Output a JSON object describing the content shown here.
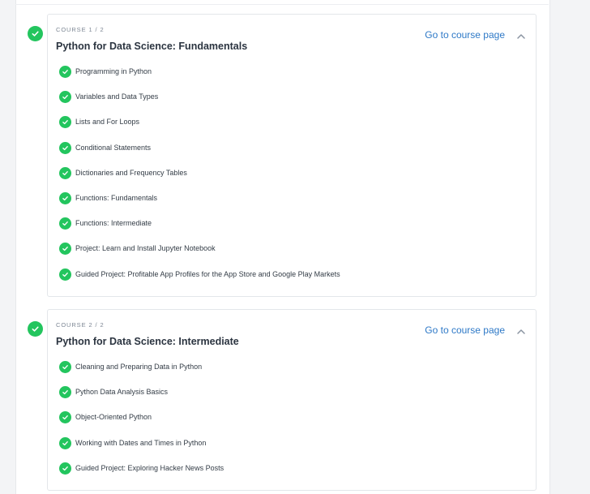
{
  "courses": [
    {
      "label": "COURSE 1 / 2",
      "title": "Python for Data Science: Fundamentals",
      "link_text": "Go to course page",
      "lessons": [
        "Programming in Python",
        "Variables and Data Types",
        "Lists and For Loops",
        "Conditional Statements",
        "Dictionaries and Frequency Tables",
        "Functions: Fundamentals",
        "Functions: Intermediate",
        "Project: Learn and Install Jupyter Notebook",
        "Guided Project: Profitable App Profiles for the App Store and Google Play Markets"
      ]
    },
    {
      "label": "COURSE 2 / 2",
      "title": "Python for Data Science: Intermediate",
      "link_text": "Go to course page",
      "lessons": [
        "Cleaning and Preparing Data in Python",
        "Python Data Analysis Basics",
        "Object-Oriented Python",
        "Working with Dates and Times in Python",
        "Guided Project: Exploring Hacker News Posts"
      ]
    }
  ],
  "colors": {
    "complete": "#23c55e",
    "link": "#2e79c7",
    "title": "#2b3440"
  },
  "icons": {
    "status": "check-circle-icon",
    "collapse": "chevron-up-icon"
  }
}
